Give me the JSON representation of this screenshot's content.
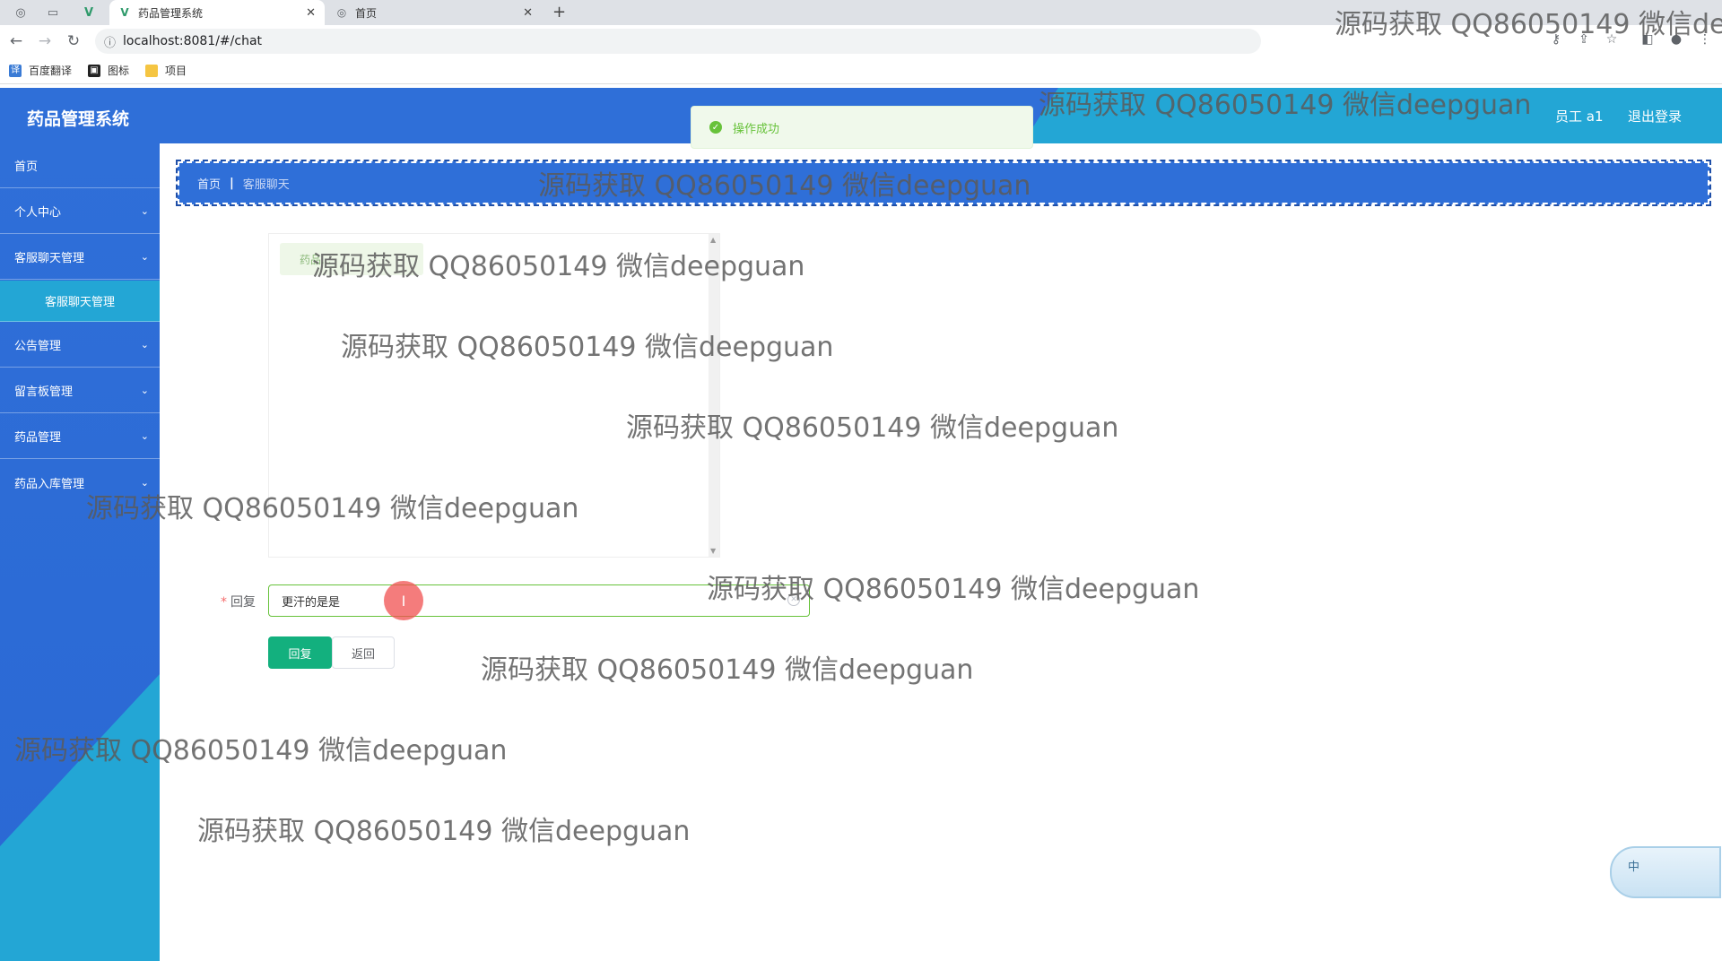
{
  "browser": {
    "tabs": [
      {
        "title": "药品管理系统",
        "active": true
      },
      {
        "title": "首页",
        "active": false
      }
    ],
    "new_tab": "+",
    "url": "localhost:8081/#/chat",
    "bookmarks": [
      "百度翻译",
      "图标",
      "项目"
    ]
  },
  "header": {
    "title": "药品管理系统",
    "user": "员工 a1",
    "logout": "退出登录"
  },
  "toast": {
    "message": "操作成功"
  },
  "sidebar": {
    "items": [
      {
        "label": "首页",
        "expandable": false
      },
      {
        "label": "个人中心",
        "expandable": true
      },
      {
        "label": "客服聊天管理",
        "expandable": true
      },
      {
        "label": "客服聊天管理",
        "sub": true
      },
      {
        "label": "公告管理",
        "expandable": true
      },
      {
        "label": "留言板管理",
        "expandable": true
      },
      {
        "label": "药品管理",
        "expandable": true
      },
      {
        "label": "药品入库管理",
        "expandable": true
      }
    ]
  },
  "breadcrumb": {
    "home": "首页",
    "current": "客服聊天"
  },
  "chat": {
    "bubble": "药品..."
  },
  "form": {
    "reply_label": "回复",
    "reply_value": "更汗的是是",
    "reply_button": "回复",
    "back_button": "返回"
  },
  "ime": {
    "label": "中"
  },
  "watermark": "源码获取 QQ86050149 微信deepguan",
  "colors": {
    "header_blue": "#2f6fd8",
    "accent_cyan": "#23a6d5",
    "primary_green": "#13b07e",
    "toast_green": "#67c23a"
  }
}
